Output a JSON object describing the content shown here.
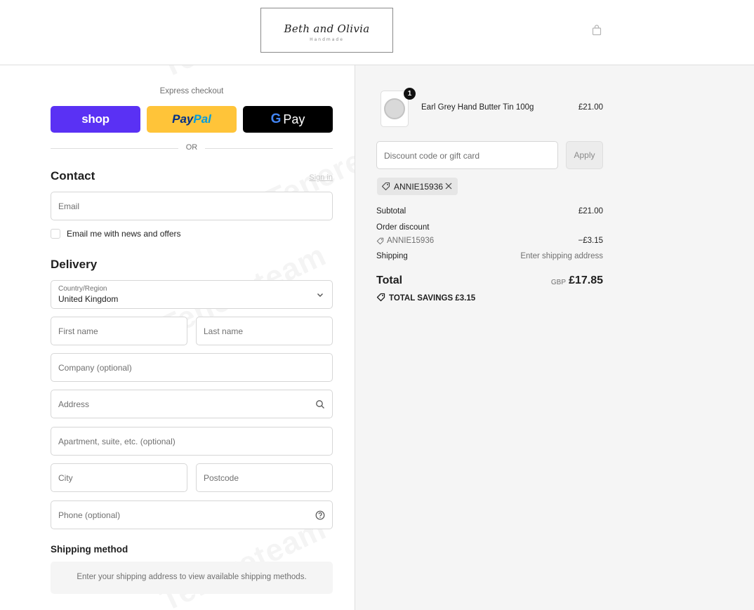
{
  "header": {
    "logo_name": "Beth and Olivia",
    "logo_sub": "Handmade",
    "cart_icon": "shopping-bag-icon"
  },
  "express": {
    "title": "Express checkout",
    "shop_label": "shop",
    "paypal_part1": "Pay",
    "paypal_part2": "Pal",
    "gpay_g": "G",
    "gpay_label": "Pay",
    "or_label": "OR"
  },
  "contact": {
    "title": "Contact",
    "signin_label": "Sign in",
    "email_placeholder": "Email",
    "newsletter_label": "Email me with news and offers"
  },
  "delivery": {
    "title": "Delivery",
    "country_label": "Country/Region",
    "country_value": "United Kingdom",
    "first_name_placeholder": "First name",
    "last_name_placeholder": "Last name",
    "company_placeholder": "Company (optional)",
    "address_placeholder": "Address",
    "apartment_placeholder": "Apartment, suite, etc. (optional)",
    "city_placeholder": "City",
    "postcode_placeholder": "Postcode",
    "phone_placeholder": "Phone (optional)"
  },
  "shipping_method": {
    "title": "Shipping method",
    "message": "Enter your shipping address to view available shipping methods."
  },
  "summary": {
    "product": {
      "name": "Earl Grey Hand Butter Tin 100g",
      "price": "£21.00",
      "quantity": "1"
    },
    "discount_placeholder": "Discount code or gift card",
    "apply_label": "Apply",
    "applied_code": "ANNIE15936",
    "subtotal_label": "Subtotal",
    "subtotal_value": "£21.00",
    "order_discount_label": "Order discount",
    "order_discount_code": "ANNIE15936",
    "order_discount_value": "−£3.15",
    "shipping_label": "Shipping",
    "shipping_value": "Enter shipping address",
    "total_label": "Total",
    "total_currency": "GBP",
    "total_value": "£17.85",
    "savings_label": "TOTAL SAVINGS",
    "savings_value": "£3.15"
  },
  "colors": {
    "shop_pay": "#5a31f4",
    "paypal": "#ffc439",
    "gpay": "#000000"
  },
  "watermark": "Tenereteam"
}
